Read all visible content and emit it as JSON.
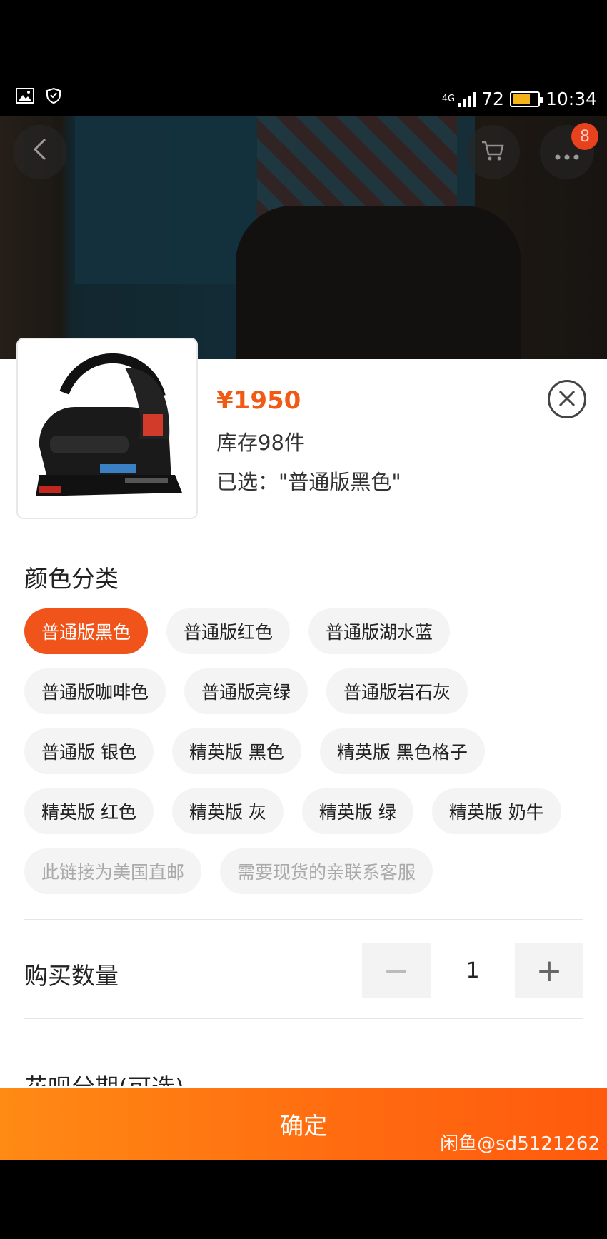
{
  "status_bar": {
    "network": "4G",
    "battery_percent": "72",
    "time": "10:34",
    "battery_fill": 0.72,
    "battery_color": "#f5b31a"
  },
  "header": {
    "back_icon": "chevron-left-icon",
    "cart_icon": "cart-icon",
    "more_icon": "more-icon",
    "badge_count": "8"
  },
  "product": {
    "price": "¥1950",
    "stock": "库存98件",
    "selected": "已选：\"普通版黑色\""
  },
  "color_section": {
    "title": "颜色分类",
    "options": [
      {
        "label": "普通版黑色",
        "state": "selected"
      },
      {
        "label": "普通版红色",
        "state": "normal"
      },
      {
        "label": "普通版湖水蓝",
        "state": "normal"
      },
      {
        "label": "普通版咖啡色",
        "state": "normal"
      },
      {
        "label": "普通版亮绿",
        "state": "normal"
      },
      {
        "label": "普通版岩石灰",
        "state": "normal"
      },
      {
        "label": "普通版 银色",
        "state": "normal"
      },
      {
        "label": "精英版 黑色",
        "state": "normal"
      },
      {
        "label": "精英版 黑色格子",
        "state": "normal"
      },
      {
        "label": "精英版 红色",
        "state": "normal"
      },
      {
        "label": "精英版 灰",
        "state": "normal"
      },
      {
        "label": "精英版 绿",
        "state": "normal"
      },
      {
        "label": "精英版 奶牛",
        "state": "normal"
      },
      {
        "label": "此链接为美国直邮",
        "state": "disabled"
      },
      {
        "label": "需要现货的亲联系客服",
        "state": "disabled"
      }
    ]
  },
  "quantity": {
    "label": "购买数量",
    "value": "1",
    "minus": "−",
    "plus": "+"
  },
  "installment": {
    "label": "花呗分期(可选)"
  },
  "footer": {
    "confirm_label": "确定",
    "watermark": "闲鱼@sd5121262"
  },
  "colors": {
    "accent": "#f0541a",
    "price": "#f05a14"
  }
}
